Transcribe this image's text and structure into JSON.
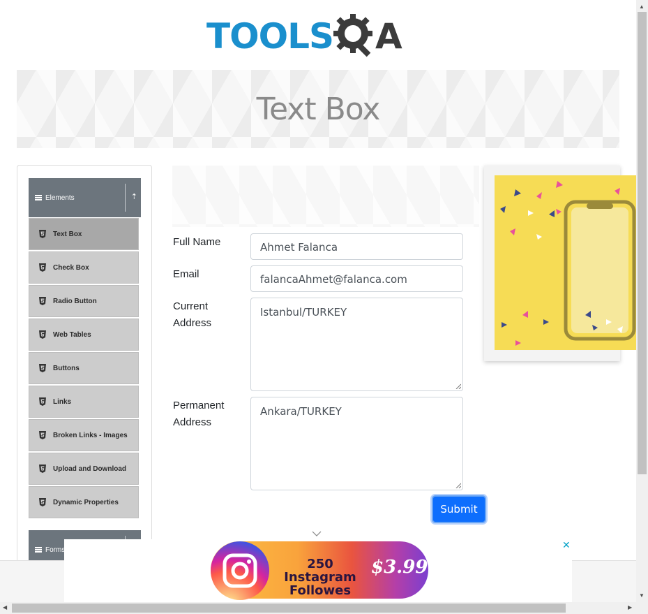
{
  "logo": {
    "part1": "TOOLS",
    "part2": "A"
  },
  "page_title": "Text Box",
  "sidebar": {
    "group_label": "Elements",
    "group2_label": "Forms",
    "items": [
      {
        "label": "Text Box"
      },
      {
        "label": "Check Box"
      },
      {
        "label": "Radio Button"
      },
      {
        "label": "Web Tables"
      },
      {
        "label": "Buttons"
      },
      {
        "label": "Links"
      },
      {
        "label": "Broken Links - Images"
      },
      {
        "label": "Upload and Download"
      },
      {
        "label": "Dynamic Properties"
      }
    ]
  },
  "form": {
    "full_name_label": "Full Name",
    "full_name_value": "Ahmet Falanca",
    "email_label": "Email",
    "email_value": "falancaAhmet@falanca.com",
    "current_address_label_1": "Current",
    "current_address_label_2": "Address",
    "current_address_value": "Istanbul/TURKEY",
    "permanent_address_label_1": "Permanent",
    "permanent_address_label_2": "Address",
    "permanent_address_value": "Ankara/TURKEY",
    "submit_label": "Submit"
  },
  "bottom_ad": {
    "line1": "250 Instagram",
    "line2": "Followes",
    "price": "$3.99",
    "close": "✕"
  },
  "colors": {
    "accent": "#0d6efd",
    "sidebar_header": "#6c757d",
    "logo_blue": "#1a8fcd"
  }
}
